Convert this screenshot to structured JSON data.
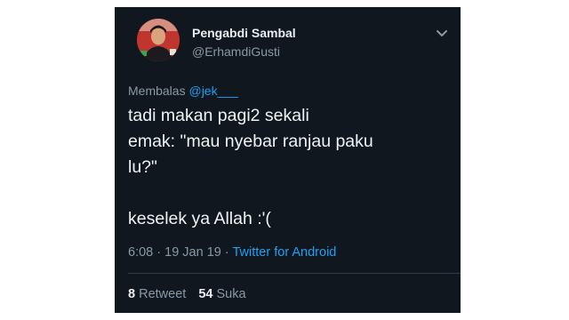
{
  "tweet": {
    "author": {
      "name": "Pengabdi Sambal",
      "handle": "@ErhamdiGusti"
    },
    "reply": {
      "prefix": "Membalas",
      "mention": "@jek___"
    },
    "text_lines": [
      "tadi makan pagi2 sekali",
      "emak: \"mau nyebar ranjau paku",
      "lu?\"",
      "",
      "keselek ya Allah :'("
    ],
    "time": "6:08",
    "separator": "·",
    "date": "19 Jan 19",
    "source": "Twitter for Android",
    "stats": {
      "retweet_count": "8",
      "retweet_label": "Retweet",
      "like_count": "54",
      "like_label": "Suka"
    }
  },
  "colors": {
    "background": "#10171e",
    "text": "#f0f3f5",
    "secondary": "#8899a6",
    "link": "#1da1f2"
  },
  "icons": {
    "menu": "chevron-down-icon"
  }
}
